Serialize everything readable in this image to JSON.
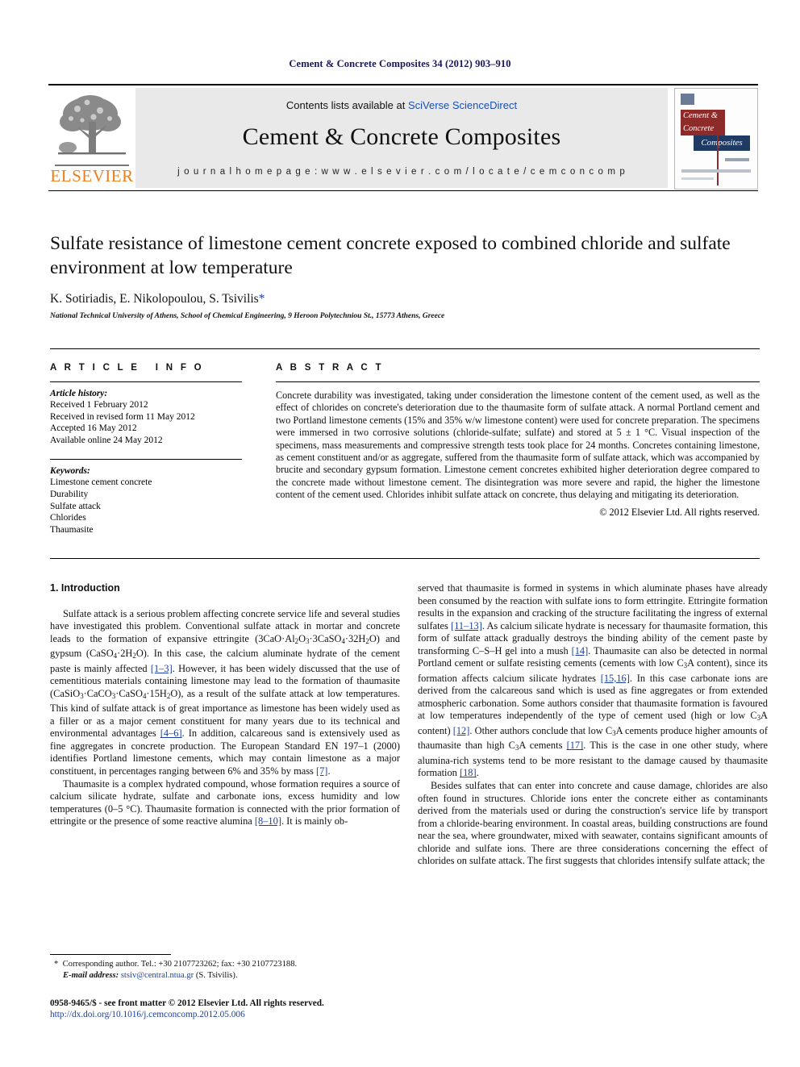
{
  "running_head": "Cement & Concrete Composites 34 (2012) 903–910",
  "masthead": {
    "contents_prefix": "Contents lists available at ",
    "contents_link": "SciVerse ScienceDirect",
    "journal_name": "Cement & Concrete Composites",
    "homepage": "j o u r n a l   h o m e p a g e :   w w w . e l s e v i e r . c o m / l o c a t e / c e m c o n c o m p",
    "publisher_name": "ELSEVIER",
    "cover": {
      "line1": "Cement &",
      "line2": "Concrete",
      "line3": "Composites"
    }
  },
  "article": {
    "title": "Sulfate resistance of limestone cement concrete exposed to combined chloride and sulfate environment at low temperature",
    "authors": "K. Sotiriadis, E. Nikolopoulou, S. Tsivilis",
    "corresponding_marker": "*",
    "affiliation": "National Technical University of Athens, School of Chemical Engineering, 9 Heroon Polytechniou St., 15773 Athens, Greece"
  },
  "article_info": {
    "heading": "ARTICLE INFO",
    "history_label": "Article history:",
    "history": [
      "Received 1 February 2012",
      "Received in revised form 11 May 2012",
      "Accepted 16 May 2012",
      "Available online 24 May 2012"
    ],
    "keywords_label": "Keywords:",
    "keywords": [
      "Limestone cement concrete",
      "Durability",
      "Sulfate attack",
      "Chlorides",
      "Thaumasite"
    ]
  },
  "abstract": {
    "heading": "ABSTRACT",
    "text": "Concrete durability was investigated, taking under consideration the limestone content of the cement used, as well as the effect of chlorides on concrete's deterioration due to the thaumasite form of sulfate attack. A normal Portland cement and two Portland limestone cements (15% and 35% w/w limestone content) were used for concrete preparation. The specimens were immersed in two corrosive solutions (chloride-sulfate; sulfate) and stored at 5 ± 1 °C. Visual inspection of the specimens, mass measurements and compressive strength tests took place for 24 months. Concretes containing limestone, as cement constituent and/or as aggregate, suffered from the thaumasite form of sulfate attack, which was accompanied by brucite and secondary gypsum formation. Limestone cement concretes exhibited higher deterioration degree compared to the concrete made without limestone cement. The disintegration was more severe and rapid, the higher the limestone content of the cement used. Chlorides inhibit sulfate attack on concrete, thus delaying and mitigating its deterioration.",
    "copyright": "© 2012 Elsevier Ltd. All rights reserved."
  },
  "body": {
    "section_heading": "1. Introduction",
    "left": {
      "p1_a": "Sulfate attack is a serious problem affecting concrete service life and several studies have investigated this problem. Conventional sulfate attack in mortar and concrete leads to the formation of expansive ettringite (3CaO·Al",
      "p1_b": "O",
      "p1_c": "·3CaSO",
      "p1_d": "·32H",
      "p1_e": "O) and gypsum (CaSO",
      "p1_f": "·2H",
      "p1_g": "O). In this case, the calcium aluminate hydrate of the cement paste is mainly affected ",
      "ref_1_3": "[1–3]",
      "p1_h": ". However, it has been widely discussed that the use of cementitious materials containing limestone may lead to the formation of thaumasite (CaSiO",
      "p1_i": "·CaCO",
      "p1_j": "·CaSO",
      "p1_k": "·15H",
      "p1_l": "O), as a result of the sulfate attack at low temperatures. This kind of sulfate attack is of great importance as limestone has been widely used as a filler or as a major cement constituent for many years due to its technical and environmental advantages ",
      "ref_4_6": "[4–6]",
      "p1_m": ". In addition, calcareous sand is extensively used as fine aggregates in concrete production. The European Standard EN 197–1 (2000) identifies Portland limestone cements, which may contain limestone as a major constituent, in percentages ranging between 6% and 35% by mass ",
      "ref_7": "[7]",
      "p1_n": ".",
      "p2_a": "Thaumasite is a complex hydrated compound, whose formation requires a source of calcium silicate hydrate, sulfate and carbonate ions, excess humidity and low temperatures (0–5 °C). Thaumasite formation is connected with the prior formation of ettringite or the presence of some reactive alumina ",
      "ref_8_10": "[8–10]",
      "p2_b": ". It is mainly ob-"
    },
    "right": {
      "p1_a": "served that thaumasite is formed in systems in which aluminate phases have already been consumed by the reaction with sulfate ions to form ettringite. Ettringite formation results in the expansion and cracking of the structure facilitating the ingress of external sulfates ",
      "ref_11_13": "[11–13]",
      "p1_b": ". As calcium silicate hydrate is necessary for thaumasite formation, this form of sulfate attack gradually destroys the binding ability of the cement paste by transforming C–S–H gel into a mush ",
      "ref_14": "[14]",
      "p1_c": ". Thaumasite can also be detected in normal Portland cement or sulfate resisting cements (cements with low C",
      "p1_d": "A content), since its formation affects calcium silicate hydrates ",
      "ref_15_16": "[15,16]",
      "p1_e": ". In this case carbonate ions are derived from the calcareous sand which is used as fine aggregates or from extended atmospheric carbonation. Some authors consider that thaumasite formation is favoured at low temperatures independently of the type of cement used (high or low C",
      "p1_f": "A content) ",
      "ref_12": "[12]",
      "p1_g": ". Other authors conclude that low C",
      "p1_h": "A cements produce higher amounts of thaumasite than high C",
      "p1_i": "A cements ",
      "ref_17": "[17]",
      "p1_j": ". This is the case in one other study, where alumina-rich systems tend to be more resistant to the damage caused by thaumasite formation ",
      "ref_18": "[18]",
      "p1_k": ".",
      "p2": "Besides sulfates that can enter into concrete and cause damage, chlorides are also often found in structures. Chloride ions enter the concrete either as contaminants derived from the materials used or during the construction's service life by transport from a chloride-bearing environment. In coastal areas, building constructions are found near the sea, where groundwater, mixed with seawater, contains significant amounts of chloride and sulfate ions. There are three considerations concerning the effect of chlorides on sulfate attack. The first suggests that chlorides intensify sulfate attack; the"
    }
  },
  "footnote": {
    "marker": "*",
    "corresponding": "Corresponding author. Tel.: +30 2107723262; fax: +30 2107723188.",
    "email_label": "E-mail address:",
    "email": "stsiv@central.ntua.gr",
    "email_owner": "(S. Tsivilis)."
  },
  "footer": {
    "issn_line": "0958-9465/$ - see front matter © 2012 Elsevier Ltd. All rights reserved.",
    "doi": "http://dx.doi.org/10.1016/j.cemconcomp.2012.05.006"
  },
  "colors": {
    "link": "#1a3fa0",
    "running_head": "#17175c",
    "elsevier_orange": "#f07d18",
    "masthead_bg": "#e9e9e9"
  }
}
